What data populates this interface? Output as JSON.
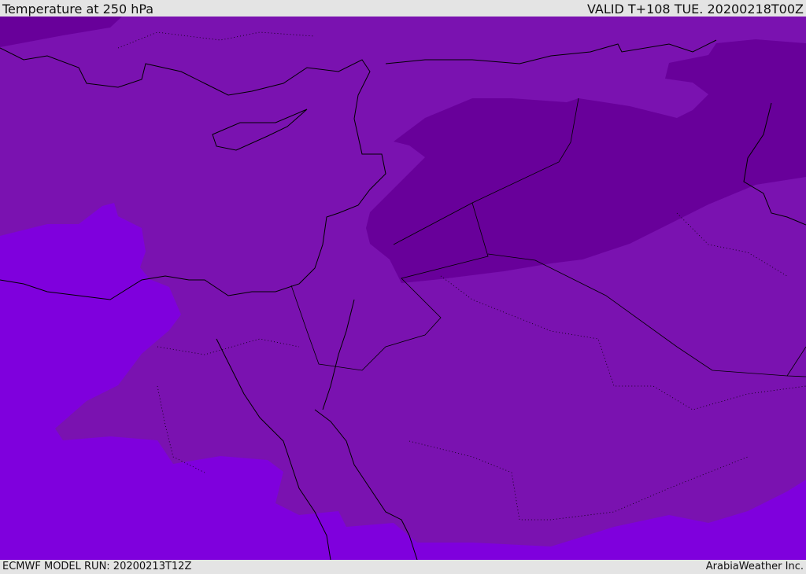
{
  "header": {
    "title": "Temperature at 250 hPa",
    "valid": "VALID T+108 TUE. 20200218T00Z"
  },
  "footer": {
    "model_run": "ECMWF MODEL RUN: 20200213T12Z",
    "credit": "ArabiaWeather Inc."
  },
  "colors": {
    "base": "#7a12b0",
    "dark": "#68009a",
    "bright": "#7f00dd",
    "bar": "#e4e4e4"
  }
}
